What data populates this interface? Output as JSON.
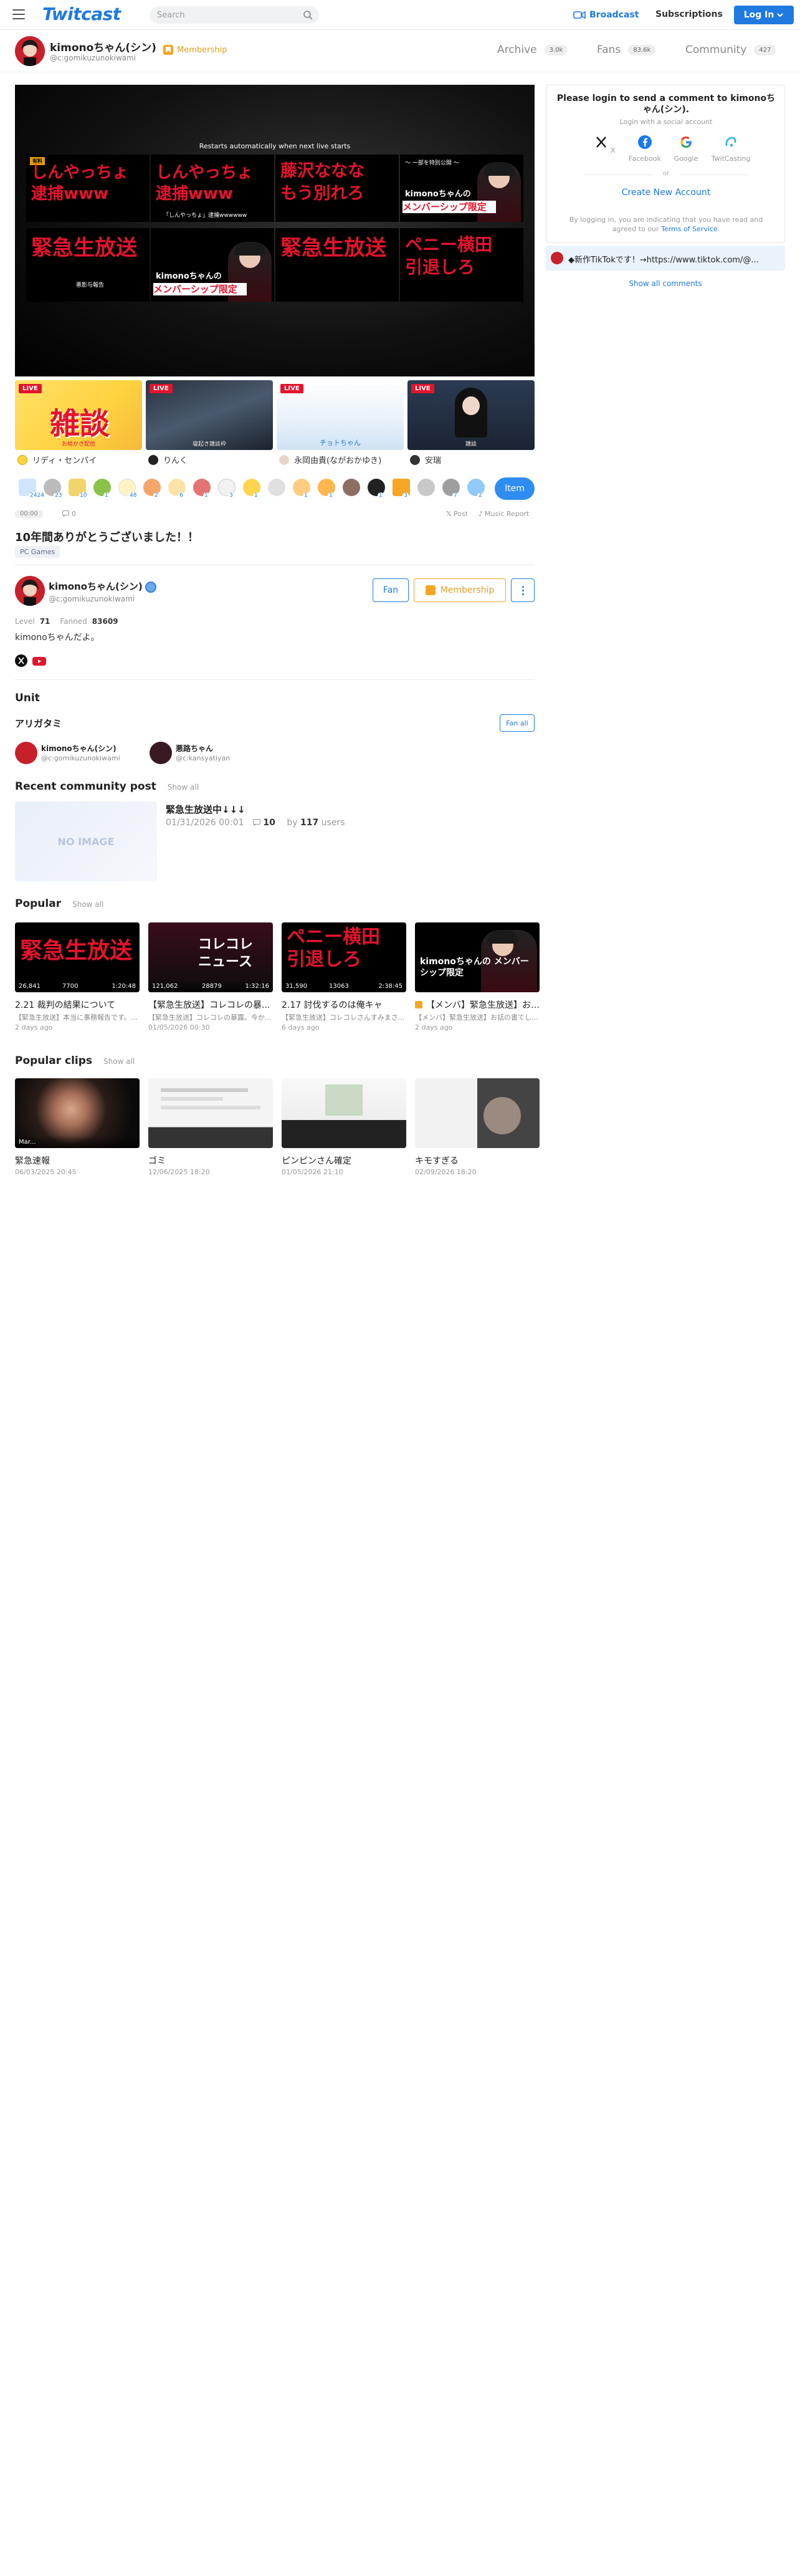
{
  "header": {
    "logo": "Twitcast",
    "search_placeholder": "Search",
    "broadcast": "Broadcast",
    "subscriptions": "Subscriptions",
    "login": "Log In"
  },
  "channel": {
    "name": "kimonoちゃん(シン)",
    "id": "@c:gomikuzunokiwami",
    "membership": "Membership",
    "tabs": [
      {
        "label": "Archive",
        "count": "3.0k"
      },
      {
        "label": "Fans",
        "count": "83.6k"
      },
      {
        "label": "Community",
        "count": "427"
      }
    ]
  },
  "player": {
    "notice": "Restarts automatically when next live starts",
    "thumbs": [
      {
        "lines": [
          "しんやっちょ",
          "逮捕www"
        ],
        "tag": "有料"
      },
      {
        "lines": [
          "しんやっちょ",
          "逮捕www"
        ],
        "caption": "「しんやっちょ」逮捕wwwwww"
      },
      {
        "lines": [
          "藤沢ななな",
          "もう別れろ"
        ]
      },
      {
        "lines": [
          "kimonoちゃんの",
          "メンバーシップ限定"
        ],
        "top": "～ 一部を特別公開 ～"
      },
      {
        "lines": [
          "緊急生放送"
        ],
        "caption": "悪影与報告"
      },
      {
        "lines": [
          "kimonoちゃんの",
          "メンバーシップ限定"
        ]
      },
      {
        "lines": [
          "緊急生放送"
        ]
      },
      {
        "lines": [
          "ペニー横田",
          "引退しろ"
        ]
      }
    ]
  },
  "lives": [
    {
      "badge": "LIVE",
      "big": "雑談",
      "caption": "お絵かき配信",
      "user": "リディ・センパイ"
    },
    {
      "badge": "LIVE",
      "caption": "寝起き雑談枠",
      "user": "りんく"
    },
    {
      "badge": "LIVE",
      "caption": "チョトちゃん",
      "user": "永岡由貴(ながおかゆき)"
    },
    {
      "badge": "LIVE",
      "caption": "雑談",
      "user": "安瑞"
    }
  ],
  "items": {
    "counts": [
      "2424",
      "23",
      "10",
      "1",
      "48",
      "2",
      "6",
      "1",
      "3",
      "1",
      "",
      "1",
      "1",
      "",
      "1",
      "3",
      "",
      "7",
      "2"
    ],
    "button": "Item"
  },
  "stats": {
    "time": "00:00",
    "comments": "0",
    "post": "Post",
    "report": "Music Report"
  },
  "movie": {
    "title": "10年間ありがとうございました！！",
    "category": "PC Games"
  },
  "profile": {
    "name": "kimonoちゃん(シン)",
    "id": "@c:gomikuzunokiwami",
    "fan_btn": "Fan",
    "membership_btn": "Membership",
    "level_label": "Level",
    "level": "71",
    "fanned_label": "Fanned",
    "fanned": "83609",
    "desc": "kimonoちゃんだよ。"
  },
  "unit": {
    "title": "Unit",
    "name": "アリガタミ",
    "fan_all": "Fan all",
    "members": [
      {
        "name": "kimonoちゃん(シン)",
        "id": "@c:gomikuzunokiwami"
      },
      {
        "name": "悪路ちゃん",
        "id": "@c:kansyatiyan"
      }
    ]
  },
  "community": {
    "title": "Recent community post",
    "show_all": "Show all",
    "noimage": "NO IMAGE",
    "post_title": "緊急生放送中↓↓↓",
    "date": "01/31/2026 00:01",
    "comments": "10",
    "by": "by",
    "users_count": "117",
    "users": "users"
  },
  "popular": {
    "title": "Popular",
    "show_all": "Show all",
    "items": [
      {
        "big": "緊急生放送",
        "views": "26,841",
        "comments": "7700",
        "dur": "1:20:48",
        "title": "2.21 裁判の結果について",
        "desc": "【緊急生放送】本当に事務報告です。...",
        "ago": "2 days ago"
      },
      {
        "big": "コレコレ ニュース",
        "views": "121,062",
        "comments": "28879",
        "dur": "1:32:16",
        "title": "【緊急生放送】コレコレの暴...",
        "desc": "【緊急生放送】コレコレの暴露。今か...",
        "ago": "01/05/2026 00:30"
      },
      {
        "big": "ペニー横田 引退しろ",
        "views": "31,590",
        "comments": "13063",
        "dur": "2:38:45",
        "title": "2.17 討伐するのは俺キャ",
        "desc": "【緊急生放送】コレコレさんすみまさ...",
        "ago": "6 days ago"
      },
      {
        "big": "kimonoちゃんの メンバーシップ限定",
        "title": "【メンバ】緊急生放送】お話...",
        "desc": "【メンバ】緊急生放送】お話の書てした...",
        "ago": "2 days ago"
      }
    ]
  },
  "clips": {
    "title": "Popular clips",
    "show_all": "Show all",
    "items": [
      {
        "label": "Mar...",
        "title": "緊急速報",
        "date": "06/03/2025 20:45"
      },
      {
        "title": "ゴミ",
        "date": "12/06/2025 18:20"
      },
      {
        "title": "ピンピンさん確定",
        "date": "01/05/2026 21:10"
      },
      {
        "title": "キモすぎる",
        "date": "02/09/2026 18:20"
      }
    ]
  },
  "login_box": {
    "title": "Please login to send a comment to kimonoちゃん(シン).",
    "sub": "Login with a social account",
    "socials": [
      "X",
      "Facebook",
      "Google",
      "TwitCasting"
    ],
    "or": "or",
    "create": "Create New Account",
    "terms_pre": "By logging in, you are indicating that you have read and agreed to our",
    "terms_link": "Terms of Service",
    "terms_post": "."
  },
  "comments": {
    "latest": "◆新作TikTokです！→https://www.tiktok.com/@...",
    "show_all": "Show all comments"
  },
  "colors": {
    "brand": "#1f7ae0",
    "live_red": "#e3142d",
    "membership_gold": "#f5a524"
  }
}
